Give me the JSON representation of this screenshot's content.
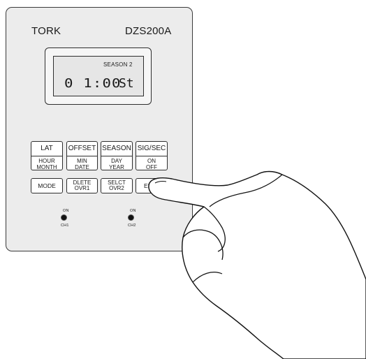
{
  "device": {
    "brand": "TORK",
    "model": "DZS200A",
    "display": {
      "label": "SEASON 2",
      "time": "0 1:00",
      "mode": "St"
    },
    "keys_top": [
      {
        "label": "LAT",
        "sub1": "HOUR",
        "sub2": "MONTH"
      },
      {
        "label": "OFFSET",
        "sub1": "MIN",
        "sub2": "DATE"
      },
      {
        "label": "SEASON",
        "sub1": "DAY",
        "sub2": "YEAR"
      },
      {
        "label": "SIG/SEC",
        "sub1": "ON",
        "sub2": "OFF"
      }
    ],
    "keys_bottom": [
      {
        "line1": "MODE"
      },
      {
        "line1": "DLETE",
        "line2": "OVR1"
      },
      {
        "line1": "SELCT",
        "line2": "OVR2"
      },
      {
        "line1": "ENT"
      }
    ],
    "channels": [
      {
        "top": "ON",
        "bottom": "CH1"
      },
      {
        "top": "ON",
        "bottom": "CH2"
      }
    ]
  }
}
